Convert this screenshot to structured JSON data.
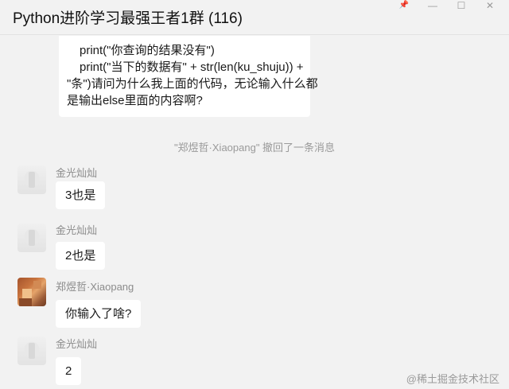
{
  "window": {
    "title": "Python进阶学习最强王者1群 (116)",
    "controls": {
      "pin": "📌",
      "minimize": "—",
      "maximize": "☐",
      "close": "✕"
    }
  },
  "messages": {
    "top_bubble": {
      "lines": [
        "print(\"你查询的结果没有\")",
        "print(\"当下的数据有\" + str(len(ku_shuju)) +",
        "\"条\")请问为什么我上面的代码，无论输入什么都",
        "是输出else里面的内容啊?"
      ]
    },
    "recall_notice": "\"郑煜哲·Xiaopang\" 撤回了一条消息",
    "items": [
      {
        "sender": "金光灿灿",
        "text": "3也是"
      },
      {
        "sender": "金光灿灿",
        "text": "2也是"
      },
      {
        "sender": "郑煜哲·Xiaopang",
        "text": "你输入了啥?"
      },
      {
        "sender": "金光灿灿",
        "text": "2"
      }
    ]
  },
  "watermark": "@稀土掘金技术社区",
  "colors": {
    "background": "#f2f2f2",
    "bubble": "#ffffff",
    "muted_text": "#9a9a9a"
  }
}
